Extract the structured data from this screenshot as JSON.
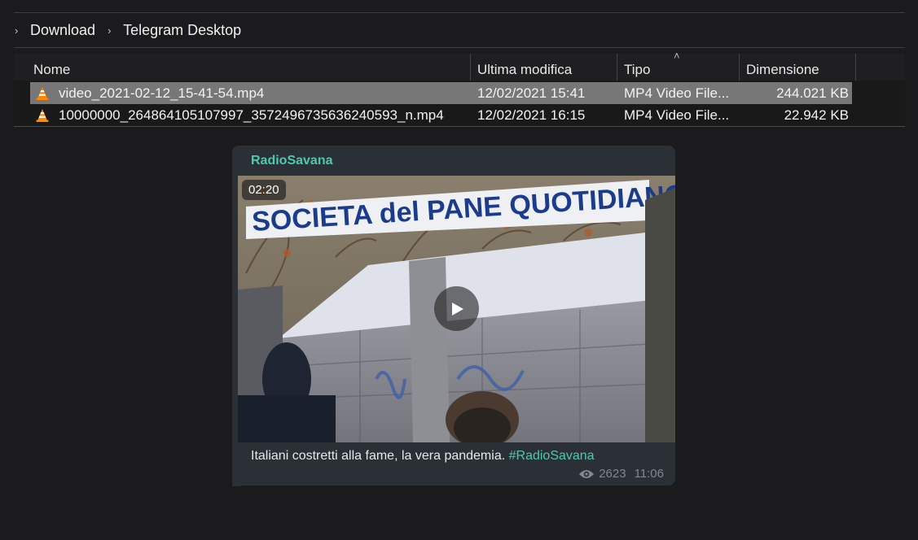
{
  "breadcrumb": {
    "items": [
      "Download",
      "Telegram Desktop"
    ]
  },
  "columns": {
    "name": "Nome",
    "modified": "Ultima modifica",
    "type": "Tipo",
    "size": "Dimensione"
  },
  "files": [
    {
      "name": "video_2021-02-12_15-41-54.mp4",
      "modified": "12/02/2021 15:41",
      "type": "MP4 Video File...",
      "size": "244.021 KB",
      "icon": "vlc-cone-icon",
      "selected": true
    },
    {
      "name": "10000000_264864105107997_3572496735636240593_n.mp4",
      "modified": "12/02/2021 16:15",
      "type": "MP4 Video File...",
      "size": "22.942 KB",
      "icon": "vlc-cone-icon",
      "selected": false
    }
  ],
  "message": {
    "author": "RadioSavana",
    "duration": "02:20",
    "video_sign_text": "SOCIETA del PANE QUOTIDIANO",
    "caption_text": "Italiani costretti alla fame, la vera pandemia. ",
    "hashtag": "#RadioSavana",
    "views": "2623",
    "time": "11:06"
  },
  "colors": {
    "accent": "#4ec9b0",
    "selection": "#777777",
    "bubble": "#2b2f36",
    "background": "#1b1b1d"
  }
}
